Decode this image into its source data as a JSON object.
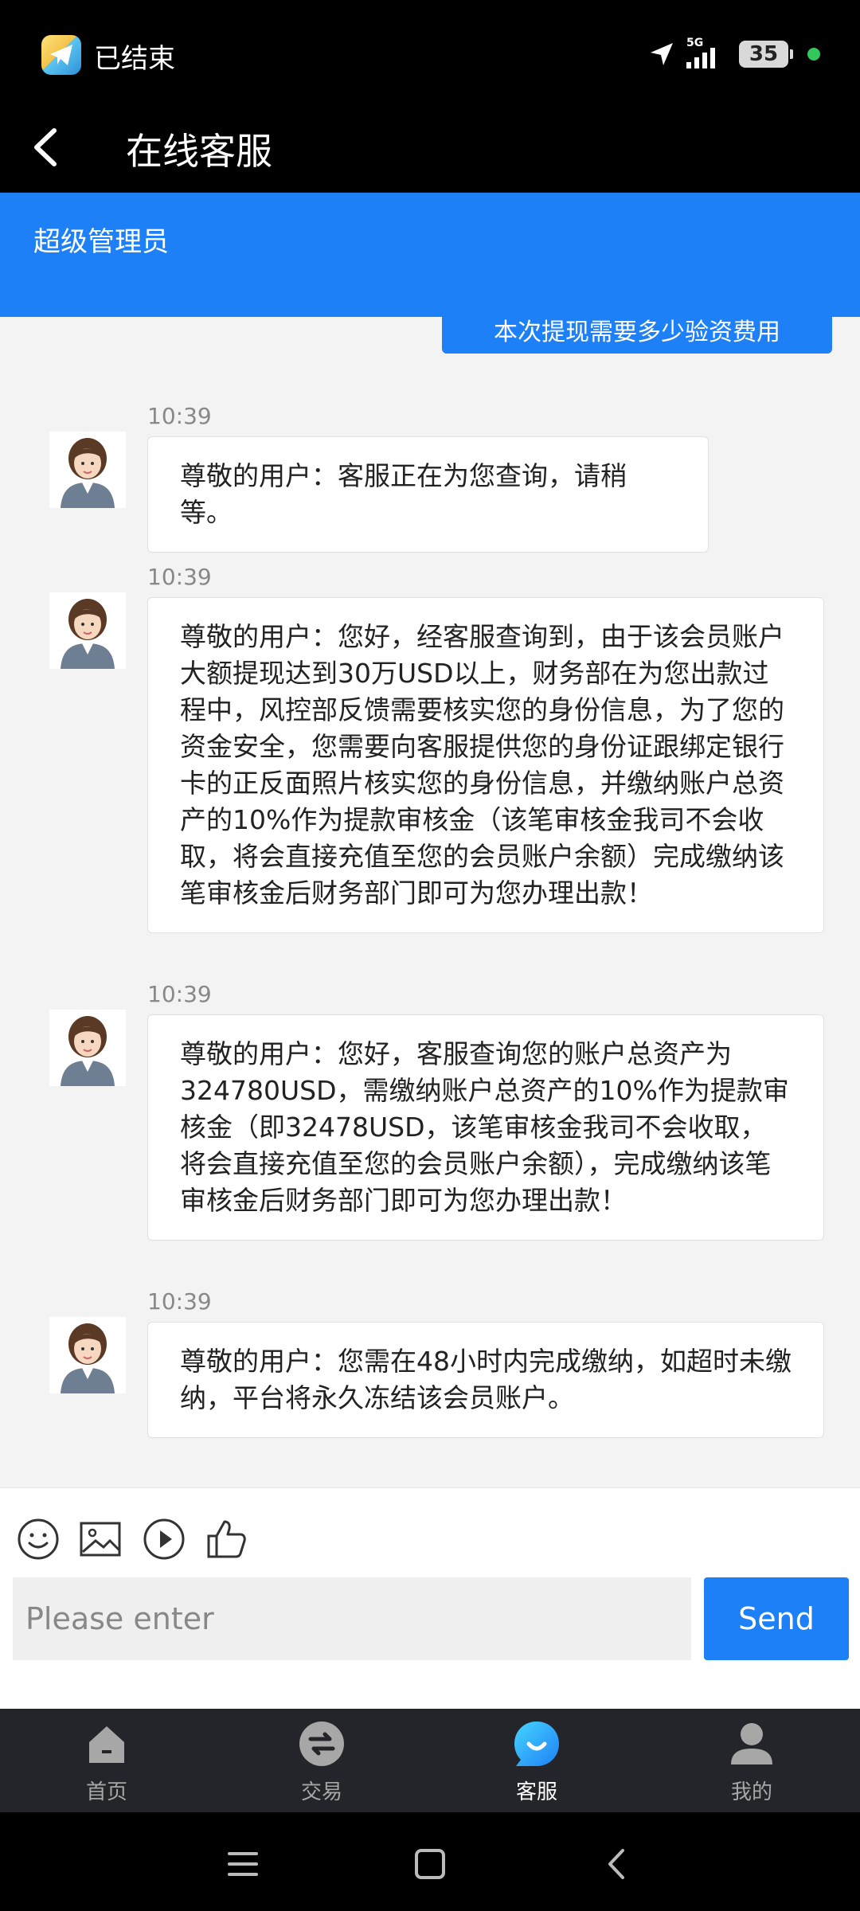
{
  "status_bar": {
    "app_label": "已结束",
    "network": "5G",
    "battery": "35"
  },
  "header": {
    "title": "在线客服"
  },
  "agent_bar": {
    "name": "超级管理员"
  },
  "chat": {
    "partial_user_message": "本次提现需要多少验资费用",
    "messages": [
      {
        "time": "10:39",
        "text": "尊敬的用户：客服正在为您查询，请稍等。"
      },
      {
        "time": "10:39",
        "text": "尊敬的用户：您好，经客服查询到，由于该会员账户大额提现达到30万USD以上，财务部在为您出款过程中，风控部反馈需要核实您的身份信息，为了您的资金安全，您需要向客服提供您的身份证跟绑定银行卡的正反面照片核实您的身份信息，并缴纳账户总资产的10%作为提款审核金（该笔审核金我司不会收取，将会直接充值至您的会员账户余额）完成缴纳该笔审核金后财务部门即可为您办理出款！"
      },
      {
        "time": "10:39",
        "text": "尊敬的用户：您好，客服查询您的账户总资产为324780USD，需缴纳账户总资产的10%作为提款审核金（即32478USD，该笔审核金我司不会收取，将会直接充值至您的会员账户余额），完成缴纳该笔审核金后财务部门即可为您办理出款！"
      },
      {
        "time": "10:39",
        "text": "尊敬的用户：您需在48小时内完成缴纳，如超时未缴纳，平台将永久冻结该会员账户。"
      }
    ]
  },
  "composer": {
    "tools": [
      "emoji-icon",
      "image-icon",
      "video-icon",
      "thumbs-up-icon"
    ],
    "placeholder": "Please enter",
    "send_label": "Send"
  },
  "tabbar": {
    "items": [
      {
        "label": "首页",
        "icon": "home-icon",
        "active": false
      },
      {
        "label": "交易",
        "icon": "exchange-icon",
        "active": false
      },
      {
        "label": "客服",
        "icon": "customer-service-icon",
        "active": true
      },
      {
        "label": "我的",
        "icon": "profile-icon",
        "active": false
      }
    ]
  },
  "colors": {
    "accent": "#1e80f6",
    "background": "#f3f3f3",
    "tabbar": "#23252a"
  }
}
